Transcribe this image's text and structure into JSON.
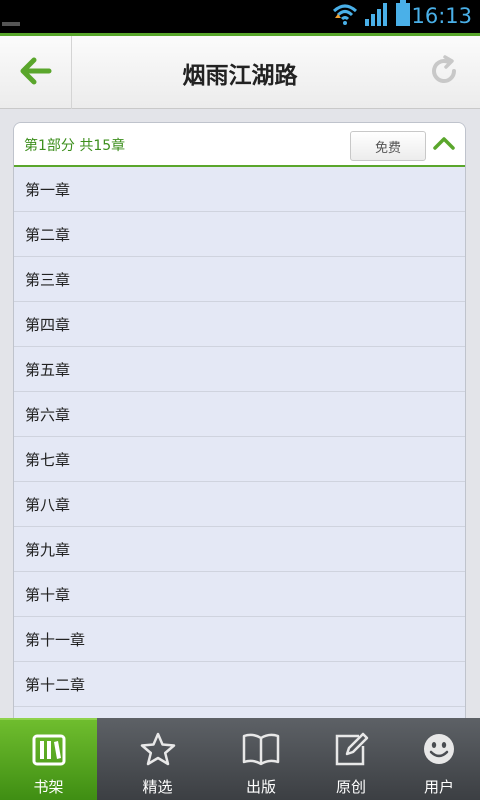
{
  "status_bar": {
    "time": "16:13",
    "icons": [
      "wifi-icon",
      "signal-icon",
      "battery-icon"
    ]
  },
  "header": {
    "title": "烟雨江湖路",
    "back_icon": "back-arrow-icon",
    "refresh_icon": "refresh-icon"
  },
  "section": {
    "title": "第1部分  共15章",
    "free_label": "免费",
    "collapse_icon": "chevron-up-icon"
  },
  "chapters": [
    "第一章",
    "第二章",
    "第三章",
    "第四章",
    "第五章",
    "第六章",
    "第七章",
    "第八章",
    "第九章",
    "第十章",
    "第十一章",
    "第十二章"
  ],
  "bottom_nav": [
    {
      "label": "书架",
      "icon": "bookshelf-icon",
      "active": true
    },
    {
      "label": "精选",
      "icon": "star-icon",
      "active": false
    },
    {
      "label": "出版",
      "icon": "book-icon",
      "active": false
    },
    {
      "label": "原创",
      "icon": "edit-icon",
      "active": false
    },
    {
      "label": "用户",
      "icon": "smiley-icon",
      "active": false
    }
  ],
  "colors": {
    "accent_green": "#57a52a",
    "status_time": "#4ab0e8",
    "list_background": "#e4e8f5"
  }
}
